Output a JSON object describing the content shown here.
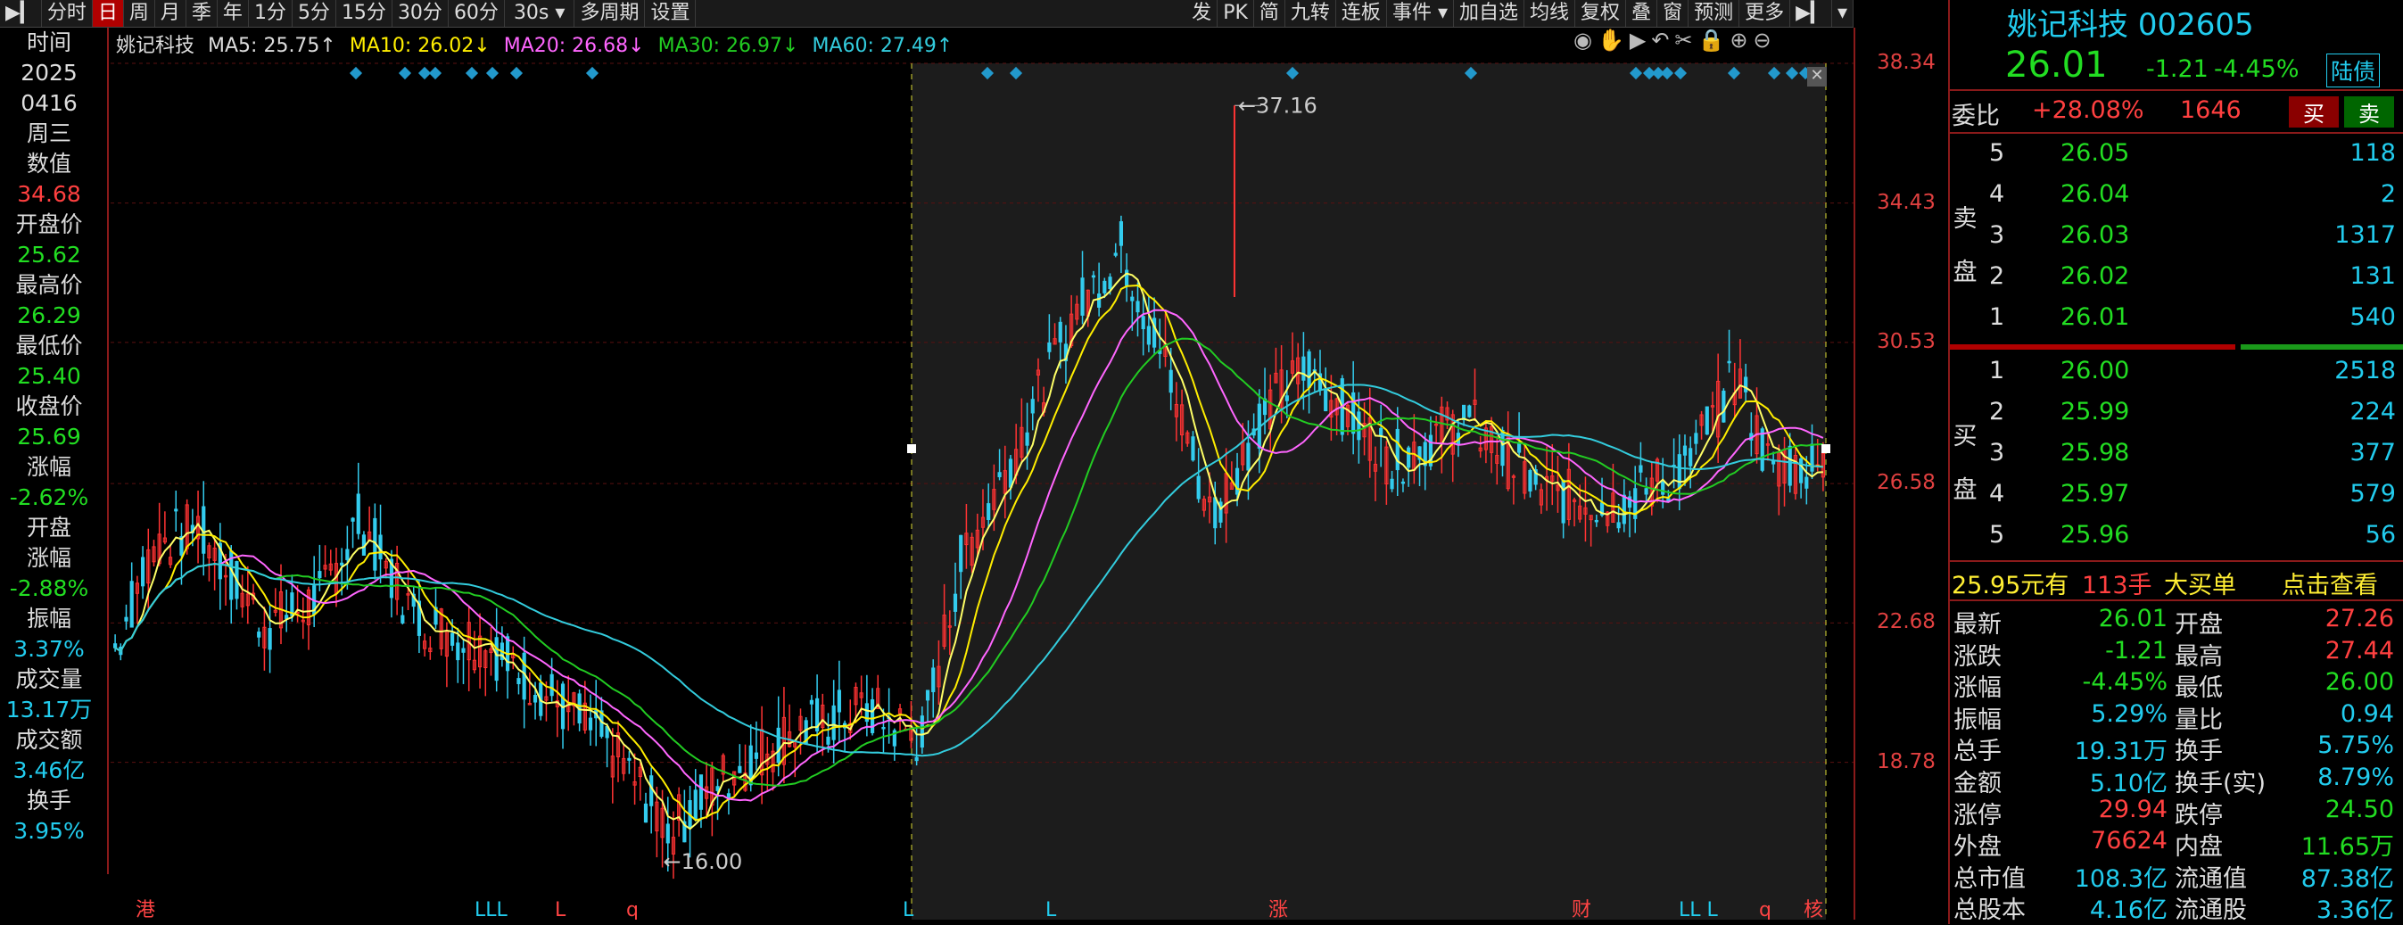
{
  "toolbar": {
    "items": [
      "分时",
      "日",
      "周",
      "月",
      "季",
      "年",
      "1分",
      "5分",
      "15分",
      "30分",
      "60分",
      "30s",
      "多周期",
      "设置"
    ],
    "active": "日",
    "right_items": [
      "发",
      "PK",
      "简",
      "九转",
      "连板",
      "事件",
      "加自选",
      "均线",
      "复权",
      "叠",
      "窗",
      "预测",
      "更多"
    ]
  },
  "legend": {
    "name": "姚记科技",
    "ma5": "MA5: 25.75↑",
    "ma10": "MA10: 26.02↓",
    "ma20": "MA20: 26.68↓",
    "ma30": "MA30: 26.97↓",
    "ma60": "MA60: 27.49↑"
  },
  "left_info": {
    "time_label": "时间",
    "year": "2025",
    "date": "0416",
    "weekday": "周三",
    "value_label": "数值",
    "value": "34.68",
    "open_label": "开盘价",
    "open": "25.62",
    "high_label": "最高价",
    "high": "26.29",
    "low_label": "最低价",
    "low": "25.40",
    "close_label": "收盘价",
    "close": "25.69",
    "chg_label": "涨幅",
    "chg": "-2.62%",
    "openchg_label1": "开盘",
    "openchg_label2": "涨幅",
    "openchg": "-2.88%",
    "amp_label": "振幅",
    "amp": "3.37%",
    "vol_label": "成交量",
    "vol": "13.17万",
    "amt_label": "成交额",
    "amt": "3.46亿",
    "turn_label": "换手",
    "turn": "3.95%"
  },
  "chart_data": {
    "type": "candlestick",
    "y_ticks": [
      "38.34",
      "34.43",
      "30.53",
      "26.58",
      "22.68",
      "18.78"
    ],
    "ylim": [
      15.5,
      38.34
    ],
    "annotations": [
      {
        "label": "37.16",
        "value": 37.16
      },
      {
        "label": "16.00",
        "value": 16.0
      }
    ],
    "bottom_markers": [
      "港",
      "LLL",
      "L",
      "q",
      "L",
      "L",
      "涨",
      "财",
      "LL L",
      "q",
      "核"
    ],
    "series": [
      {
        "name": "MA5",
        "color": "#ffff66"
      },
      {
        "name": "MA10",
        "color": "#ffee00"
      },
      {
        "name": "MA20",
        "color": "#ff66ff"
      },
      {
        "name": "MA30",
        "color": "#22cc22"
      },
      {
        "name": "MA60",
        "color": "#33ccdd"
      }
    ]
  },
  "quote": {
    "name": "姚记科技",
    "code": "002605",
    "price": "26.01",
    "change": "-1.21",
    "pct": "-4.45%",
    "tag": "陆债",
    "weibi_label": "委比",
    "weibi": "+28.08%",
    "weicha": "1646",
    "buy_btn": "买",
    "sell_btn": "卖",
    "sell_label": [
      "卖",
      "盘"
    ],
    "buy_label": [
      "买",
      "盘"
    ],
    "asks": [
      {
        "level": "5",
        "price": "26.05",
        "vol": "118"
      },
      {
        "level": "4",
        "price": "26.04",
        "vol": "2"
      },
      {
        "level": "3",
        "price": "26.03",
        "vol": "1317"
      },
      {
        "level": "2",
        "price": "26.02",
        "vol": "131"
      },
      {
        "level": "1",
        "price": "26.01",
        "vol": "540"
      }
    ],
    "bids": [
      {
        "level": "1",
        "price": "26.00",
        "vol": "2518"
      },
      {
        "level": "2",
        "price": "25.99",
        "vol": "224"
      },
      {
        "level": "3",
        "price": "25.98",
        "vol": "377"
      },
      {
        "level": "4",
        "price": "25.97",
        "vol": "579"
      },
      {
        "level": "5",
        "price": "25.96",
        "vol": "56"
      }
    ],
    "bigorder": {
      "price": "25.95元有",
      "hands": "113手",
      "label": "大买单",
      "link": "点击查看"
    },
    "stats_left": [
      {
        "k": "最新",
        "v": "26.01",
        "c": "green"
      },
      {
        "k": "涨跌",
        "v": "-1.21",
        "c": "green"
      },
      {
        "k": "涨幅",
        "v": "-4.45%",
        "c": "green"
      },
      {
        "k": "振幅",
        "v": "5.29%",
        "c": "cyan"
      },
      {
        "k": "总手",
        "v": "19.31万",
        "c": "cyan"
      },
      {
        "k": "金额",
        "v": "5.10亿",
        "c": "cyan"
      },
      {
        "k": "涨停",
        "v": "29.94",
        "c": "red"
      },
      {
        "k": "外盘",
        "v": "76624",
        "c": "red"
      },
      {
        "k": "总市值",
        "v": "108.3亿",
        "c": "cyan"
      },
      {
        "k": "总股本",
        "v": "4.16亿",
        "c": "cyan"
      }
    ],
    "stats_right": [
      {
        "k": "开盘",
        "v": "27.26",
        "c": "red"
      },
      {
        "k": "最高",
        "v": "27.44",
        "c": "red"
      },
      {
        "k": "最低",
        "v": "26.00",
        "c": "green"
      },
      {
        "k": "量比",
        "v": "0.94",
        "c": "cyan"
      },
      {
        "k": "换手",
        "v": "5.75%",
        "c": "cyan"
      },
      {
        "k": "换手(实)",
        "v": "8.79%",
        "c": "cyan"
      },
      {
        "k": "跌停",
        "v": "24.50",
        "c": "green"
      },
      {
        "k": "内盘",
        "v": "11.65万",
        "c": "green"
      },
      {
        "k": "流通值",
        "v": "87.38亿",
        "c": "cyan"
      },
      {
        "k": "流通股",
        "v": "3.36亿",
        "c": "cyan"
      }
    ]
  }
}
